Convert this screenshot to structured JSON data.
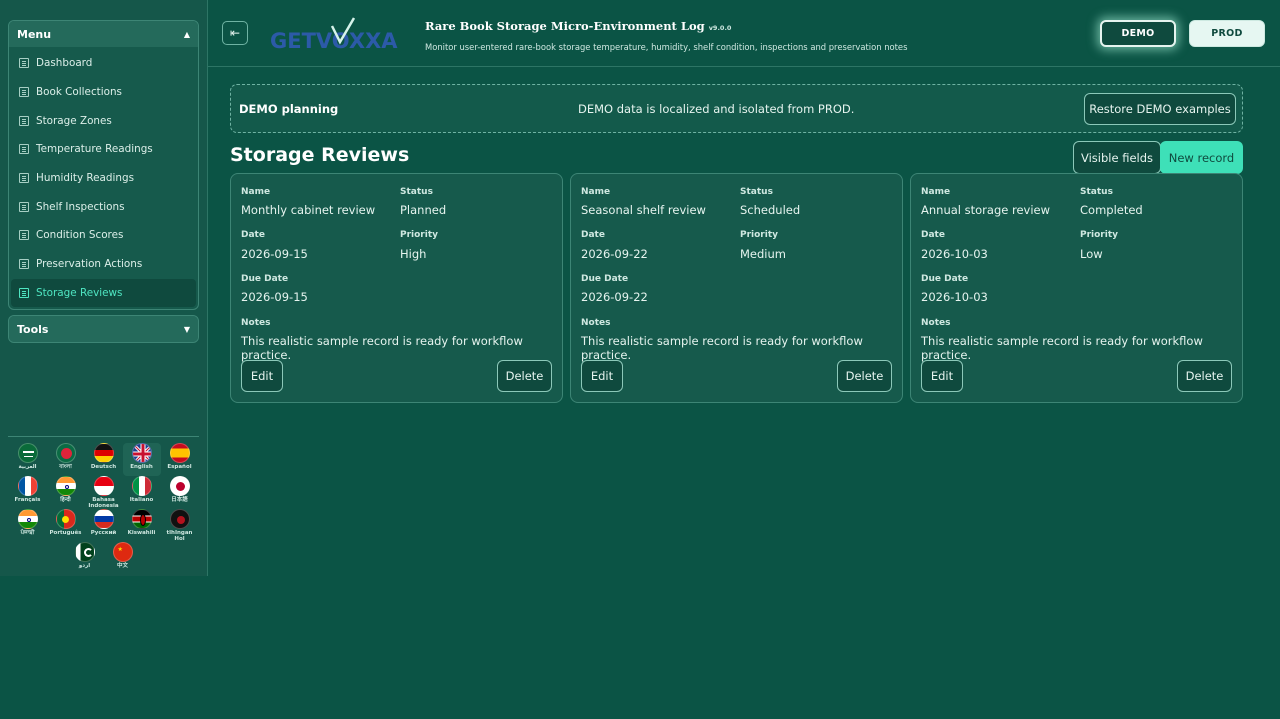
{
  "sidebar": {
    "menu_title": "Menu",
    "tools_title": "Tools",
    "items": [
      {
        "label": "Dashboard"
      },
      {
        "label": "Book Collections"
      },
      {
        "label": "Storage Zones"
      },
      {
        "label": "Temperature Readings"
      },
      {
        "label": "Humidity Readings"
      },
      {
        "label": "Shelf Inspections"
      },
      {
        "label": "Condition Scores"
      },
      {
        "label": "Preservation Actions"
      },
      {
        "label": "Storage Reviews",
        "active": true
      }
    ],
    "languages": [
      {
        "name": "العربية",
        "flag": "sa"
      },
      {
        "name": "বাংলা",
        "flag": "bd"
      },
      {
        "name": "Deutsch",
        "flag": "de"
      },
      {
        "name": "English",
        "flag": "gb",
        "selected": true
      },
      {
        "name": "Español",
        "flag": "es"
      },
      {
        "name": "Français",
        "flag": "fr"
      },
      {
        "name": "हिन्दी",
        "flag": "in"
      },
      {
        "name": "Bahasa Indonesia",
        "flag": "id"
      },
      {
        "name": "Italiano",
        "flag": "it"
      },
      {
        "name": "日本語",
        "flag": "jp"
      },
      {
        "name": "ਪੰਜਾਬੀ",
        "flag": "in"
      },
      {
        "name": "Português",
        "flag": "pt"
      },
      {
        "name": "Русский",
        "flag": "ru"
      },
      {
        "name": "Kiswahili",
        "flag": "ke"
      },
      {
        "name": "tlhIngan Hol",
        "flag": "kl"
      },
      {
        "name": "اردو",
        "flag": "pk"
      },
      {
        "name": "中文",
        "flag": "cn"
      }
    ]
  },
  "header": {
    "logo_text": "GETVOXXA",
    "title": "Rare Book Storage Micro-Environment Log",
    "version": "v9.0.0",
    "subtitle": "Monitor user-entered rare-book storage temperature, humidity, shelf condition, inspections and preservation notes",
    "demo_label": "DEMO",
    "prod_label": "PROD"
  },
  "banner": {
    "title": "DEMO planning",
    "message": "DEMO data is localized and isolated from PROD.",
    "restore_label": "Restore DEMO examples"
  },
  "main": {
    "section_title": "Storage Reviews",
    "visible_fields_label": "Visible fields",
    "new_record_label": "New record",
    "labels": {
      "name": "Name",
      "status": "Status",
      "date": "Date",
      "priority": "Priority",
      "due_date": "Due Date",
      "notes": "Notes"
    },
    "edit_label": "Edit",
    "delete_label": "Delete",
    "records": [
      {
        "name": "Monthly cabinet review",
        "status": "Planned",
        "date": "2026-09-15",
        "priority": "High",
        "due_date": "2026-09-15",
        "notes": "This realistic sample record is ready for workflow practice."
      },
      {
        "name": "Seasonal shelf review",
        "status": "Scheduled",
        "date": "2026-09-22",
        "priority": "Medium",
        "due_date": "2026-09-22",
        "notes": "This realistic sample record is ready for workflow practice."
      },
      {
        "name": "Annual storage review",
        "status": "Completed",
        "date": "2026-10-03",
        "priority": "Low",
        "due_date": "2026-10-03",
        "notes": "This realistic sample record is ready for workflow practice."
      }
    ]
  },
  "colors": {
    "background": "#0b5445",
    "accent": "#3ee0b8",
    "active_text": "#4fe6c2"
  }
}
